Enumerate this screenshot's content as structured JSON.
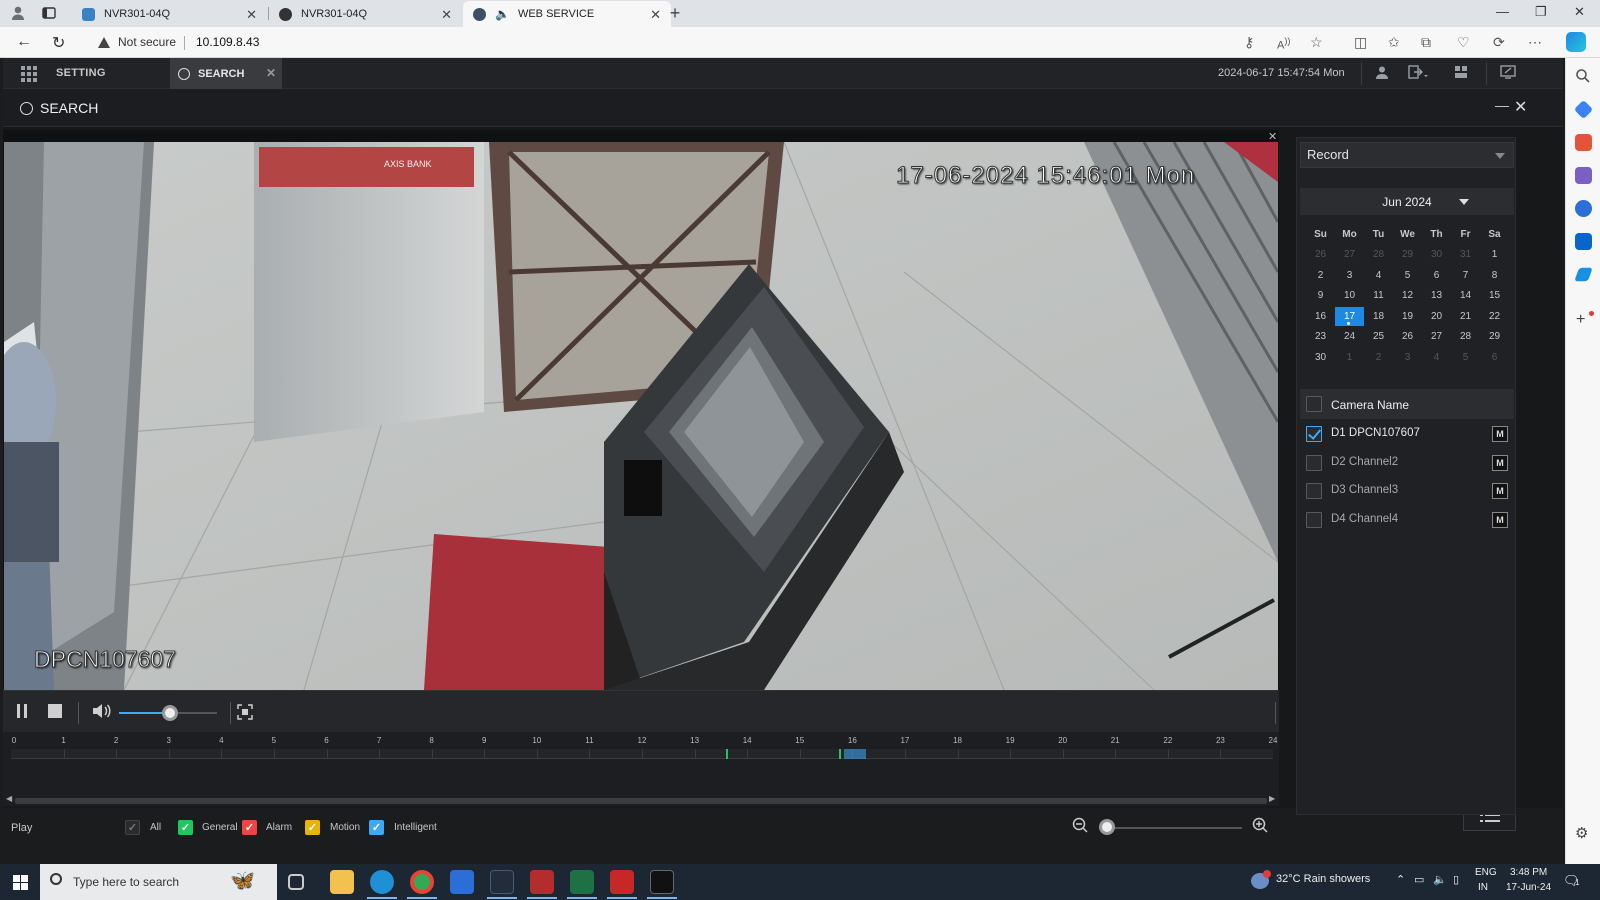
{
  "browser": {
    "tabs": [
      {
        "label": "NVR301-04Q",
        "favicon_color": "#3b82c4"
      },
      {
        "label": "NVR301-04Q",
        "favicon_color": "#444444"
      },
      {
        "label": "WEB SERVICE",
        "favicon_color": "#3d4f66"
      }
    ],
    "security_label": "Not secure",
    "url": "10.109.8.43"
  },
  "app": {
    "setting_label": "SETTING",
    "search_tab_label": "SEARCH",
    "datetime": "2024-06-17 15:47:54 Mon",
    "page_title": "SEARCH"
  },
  "video": {
    "osd_time": "17-06-2024 15:46:01 Mon",
    "osd_camera": "DPCN107607"
  },
  "timeline": {
    "hours": [
      "0",
      "1",
      "2",
      "3",
      "4",
      "5",
      "6",
      "7",
      "8",
      "9",
      "10",
      "11",
      "12",
      "13",
      "14",
      "15",
      "16",
      "17",
      "18",
      "19",
      "20",
      "21",
      "22",
      "23",
      "24"
    ],
    "marks": [
      {
        "hour": 13.6,
        "color": "#22c55e"
      },
      {
        "hour": 15.75,
        "color": "#22c55e"
      },
      {
        "hour": 15.85,
        "color": "#3fa9f5"
      }
    ]
  },
  "filters": {
    "play_label": "Play",
    "items": [
      {
        "label": "All",
        "color": "#2a2b2e",
        "checked": true
      },
      {
        "label": "General",
        "color": "#22c55e",
        "checked": true
      },
      {
        "label": "Alarm",
        "color": "#ef4444",
        "checked": true
      },
      {
        "label": "Motion",
        "color": "#eab308",
        "checked": true
      },
      {
        "label": "Intelligent",
        "color": "#3fa9f5",
        "checked": true
      }
    ]
  },
  "panel": {
    "record_type": "Record",
    "month_label": "Jun 2024",
    "weekdays": [
      "Su",
      "Mo",
      "Tu",
      "We",
      "Th",
      "Fr",
      "Sa"
    ],
    "weeks": [
      [
        "26",
        "27",
        "28",
        "29",
        "30",
        "31",
        "1"
      ],
      [
        "2",
        "3",
        "4",
        "5",
        "6",
        "7",
        "8"
      ],
      [
        "9",
        "10",
        "11",
        "12",
        "13",
        "14",
        "15"
      ],
      [
        "16",
        "17",
        "18",
        "19",
        "20",
        "21",
        "22"
      ],
      [
        "23",
        "24",
        "25",
        "26",
        "27",
        "28",
        "29"
      ],
      [
        "30",
        "1",
        "2",
        "3",
        "4",
        "5",
        "6"
      ]
    ],
    "selected_day": "17",
    "camera_header": "Camera Name",
    "cameras": [
      {
        "label": "D1 DPCN107607",
        "checked": true,
        "m": "M"
      },
      {
        "label": "D2 Channel2",
        "checked": false,
        "m": "M"
      },
      {
        "label": "D3 Channel3",
        "checked": false,
        "m": "M"
      },
      {
        "label": "D4 Channel4",
        "checked": false,
        "m": "M"
      }
    ]
  },
  "taskbar": {
    "search_placeholder": "Type here to search",
    "weather": "32°C  Rain showers",
    "lang1": "ENG",
    "lang2": "IN",
    "time": "3:48 PM",
    "date": "17-Jun-24",
    "notif_count": "1"
  }
}
